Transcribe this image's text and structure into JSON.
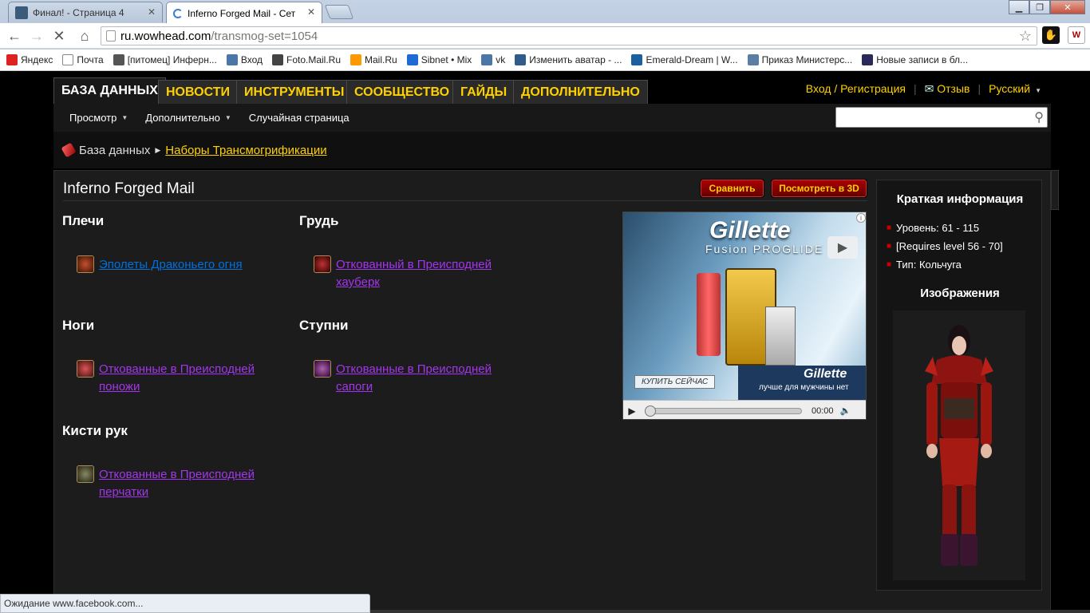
{
  "browser": {
    "tabs": [
      {
        "title": "Финал! - Страница 4"
      },
      {
        "title": "Inferno Forged Mail - Сет"
      }
    ],
    "url_host": "ru.wowhead.com",
    "url_path": "/transmog-set=1054",
    "bookmarks": [
      {
        "label": "Яндекс",
        "icon": "yandex-icon"
      },
      {
        "label": "Почта",
        "icon": "page-icon"
      },
      {
        "label": "[питомец] Инферн...",
        "icon": "paw-icon"
      },
      {
        "label": "Вход",
        "icon": "vk-icon"
      },
      {
        "label": "Foto.Mail.Ru",
        "icon": "camera-icon"
      },
      {
        "label": "Mail.Ru",
        "icon": "mailru-icon"
      },
      {
        "label": "Sibnet • Mix",
        "icon": "sibnet-icon"
      },
      {
        "label": "vk",
        "icon": "vk-icon"
      },
      {
        "label": "Изменить аватар - ...",
        "icon": "site-icon"
      },
      {
        "label": "Emerald-Dream | W...",
        "icon": "emerald-icon"
      },
      {
        "label": "Приказ Министерс...",
        "icon": "pg-icon"
      },
      {
        "label": "Новые записи в бл...",
        "icon": "fk-icon"
      }
    ],
    "status_text": "Ожидание www.facebook.com..."
  },
  "nav": {
    "tabs": [
      "База данных",
      "Новости",
      "Инструменты",
      "Сообщество",
      "Гайды",
      "Дополнительно"
    ],
    "login": "Вход / Регистрация",
    "feedback": "Отзыв",
    "language": "Русский",
    "sub": [
      "Просмотр",
      "Дополнительно",
      "Случайная страница"
    ]
  },
  "breadcrumb": {
    "root": "База данных",
    "current": "Наборы Трансмогрификации"
  },
  "set": {
    "title": "Inferno Forged Mail",
    "compare_btn": "Сравнить",
    "view3d_btn": "Посмотреть в 3D",
    "slots": [
      {
        "heading": "Плечи",
        "item": "Эполеты Драконьего огня",
        "quality_color": "#0070dd"
      },
      {
        "heading": "Грудь",
        "item": "Откованный в Преисподней хауберк",
        "quality_color": "#a335ee"
      },
      {
        "heading": "Ноги",
        "item": "Откованные в Преисподней поножи",
        "quality_color": "#a335ee"
      },
      {
        "heading": "Ступни",
        "item": "Откованные в Преисподней сапоги",
        "quality_color": "#a335ee"
      },
      {
        "heading": "Кисти рук",
        "item": "Откованные в Преисподней перчатки",
        "quality_color": "#a335ee"
      }
    ]
  },
  "ad": {
    "brand": "Gillette",
    "product": "Fusion PROGLIDE",
    "buy": "КУПИТЬ СЕЙЧАС",
    "banner_brand": "Gillette",
    "tagline": "лучше для мужчины нет",
    "time": "00:00"
  },
  "sidebar": {
    "quick_title": "Краткая информация",
    "facts": [
      "Уровень: 61 - 115",
      "[Requires level 56 - 70]",
      "Тип: Кольчуга"
    ],
    "images_title": "Изображения"
  },
  "colors": {
    "accent": "#ffd100",
    "uncommon_link": "#0070dd",
    "epic_link": "#a335ee",
    "button_red": "#990000"
  }
}
